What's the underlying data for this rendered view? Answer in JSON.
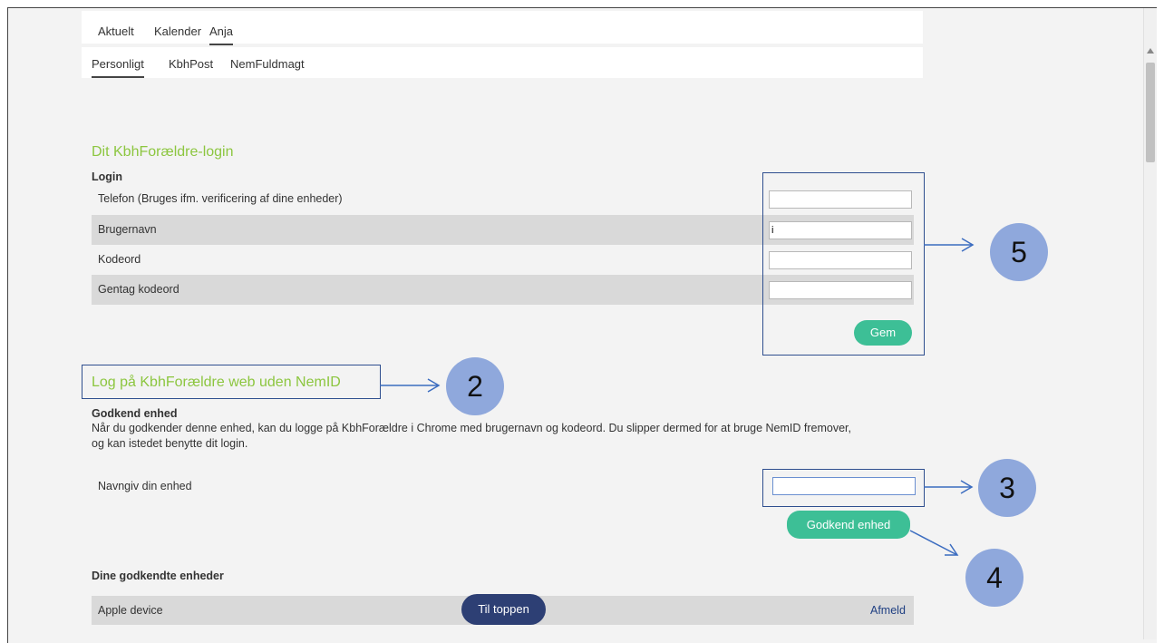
{
  "nav": {
    "primary": [
      "Aktuelt",
      "Kalender",
      "Anja"
    ],
    "secondary": [
      "Personligt",
      "KbhPost",
      "NemFuldmagt"
    ]
  },
  "login_section": {
    "title": "Dit KbhForældre-login",
    "subtitle": "Login",
    "rows": [
      {
        "label": "Telefon (Bruges ifm. verificering af dine enheder)",
        "value": ""
      },
      {
        "label": "Brugernavn",
        "value": "i"
      },
      {
        "label": "Kodeord",
        "value": ""
      },
      {
        "label": "Gentag kodeord",
        "value": ""
      }
    ],
    "save_label": "Gem"
  },
  "device_section": {
    "title": "Log på KbhForældre web uden NemID",
    "subtitle": "Godkend enhed",
    "description_line1": "Når du godkender denne enhed, kan du logge på KbhForældre i Chrome med brugernavn og kodeord. Du slipper dermed for at bruge NemID fremover,",
    "description_line2": "og kan istedet benytte dit login.",
    "name_label": "Navngiv din enhed",
    "name_value": "",
    "approve_label": "Godkend enhed"
  },
  "approved_devices": {
    "title": "Dine godkendte enheder",
    "items": [
      {
        "name": "Apple device",
        "action": "Afmeld"
      }
    ]
  },
  "to_top_label": "Til toppen",
  "annotations": {
    "n2": "2",
    "n3": "3",
    "n4": "4",
    "n5": "5"
  },
  "colors": {
    "accent_green": "#8cc63f",
    "button_green": "#3dbf96",
    "annotation_blue": "#8fa8dc",
    "dark_blue": "#2d3f74"
  }
}
